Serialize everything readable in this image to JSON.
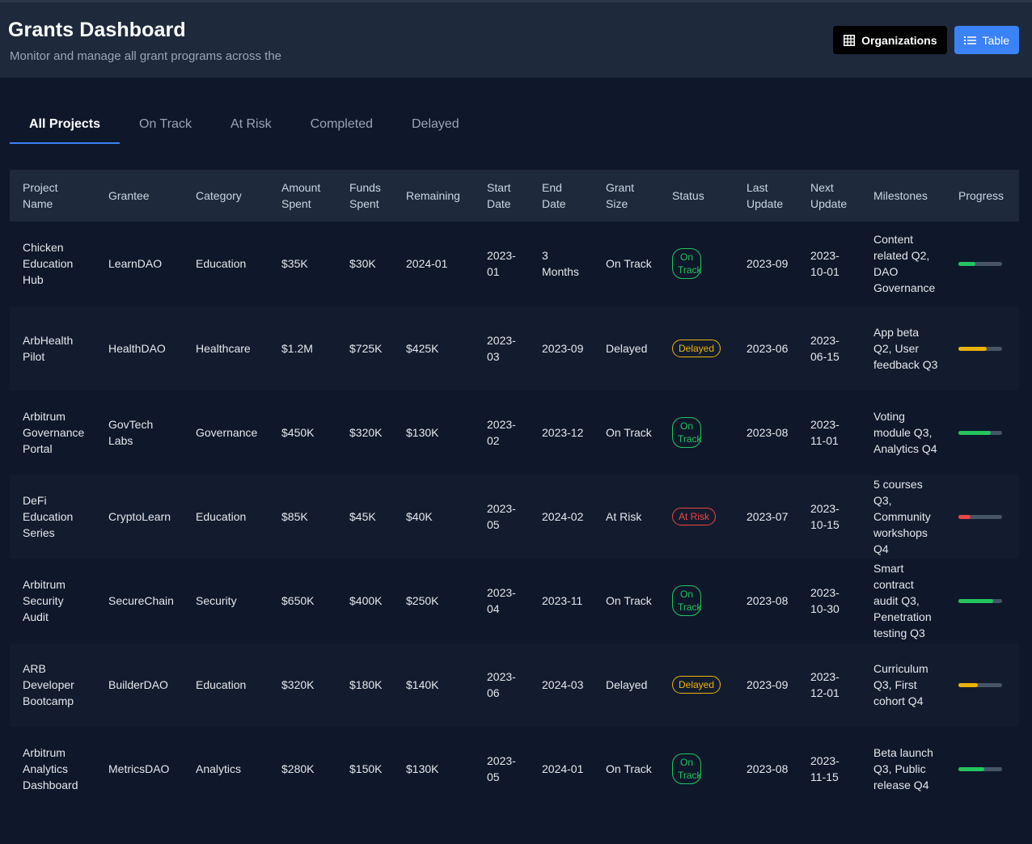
{
  "header": {
    "title": "Grants Dashboard",
    "subtitle": "Monitor and manage all grant programs across the",
    "organizations_label": "Organizations",
    "table_label": "Table"
  },
  "tabs": [
    {
      "label": "All Projects",
      "active": true
    },
    {
      "label": "On Track",
      "active": false
    },
    {
      "label": "At Risk",
      "active": false
    },
    {
      "label": "Completed",
      "active": false
    },
    {
      "label": "Delayed",
      "active": false
    }
  ],
  "table": {
    "columns": [
      "Project Name",
      "Grantee",
      "Category",
      "Amount Spent",
      "Funds Spent",
      "Remaining",
      "Start Date",
      "End Date",
      "Grant Size",
      "Status",
      "Last Update",
      "Next Update",
      "Milestones",
      "Progress"
    ],
    "rows": [
      {
        "project": "Chicken Education Hub",
        "grantee": "LearnDAO",
        "category": "Education",
        "amount_spent": "$35K",
        "funds_spent": "$30K",
        "remaining": "2024-01",
        "start": "2023-01",
        "end": "3 Months",
        "grant_size": "On Track",
        "status": "On Track",
        "status_type": "ontrack",
        "last_update": "2023-09",
        "next_update": "2023-10-01",
        "milestones": "Content related Q2, DAO Governance",
        "progress": 0.38,
        "progress_color": "#22c55e"
      },
      {
        "project": "ArbHealth Pilot",
        "grantee": "HealthDAO",
        "category": "Healthcare",
        "amount_spent": "$1.2M",
        "funds_spent": "$725K",
        "remaining": "$425K",
        "start": "2023-03",
        "end": "2023-09",
        "grant_size": "Delayed",
        "status": "Delayed",
        "status_type": "delayed",
        "last_update": "2023-06",
        "next_update": "2023-06-15",
        "milestones": "App beta Q2, User feedback Q3",
        "progress": 0.65,
        "progress_color": "#eab308"
      },
      {
        "project": "Arbitrum Governance Portal",
        "grantee": "GovTech Labs",
        "category": "Governance",
        "amount_spent": "$450K",
        "funds_spent": "$320K",
        "remaining": "$130K",
        "start": "2023-02",
        "end": "2023-12",
        "grant_size": "On Track",
        "status": "On Track",
        "status_type": "ontrack",
        "last_update": "2023-08",
        "next_update": "2023-11-01",
        "milestones": "Voting module Q3, Analytics Q4",
        "progress": 0.74,
        "progress_color": "#22c55e"
      },
      {
        "project": "DeFi Education Series",
        "grantee": "CryptoLearn",
        "category": "Education",
        "amount_spent": "$85K",
        "funds_spent": "$45K",
        "remaining": "$40K",
        "start": "2023-05",
        "end": "2024-02",
        "grant_size": "At Risk",
        "status": "At Risk",
        "status_type": "atrisk",
        "last_update": "2023-07",
        "next_update": "2023-10-15",
        "milestones": "5 courses Q3, Community workshops Q4",
        "progress": 0.28,
        "progress_color": "#ef4444"
      },
      {
        "project": "Arbitrum Security Audit",
        "grantee": "SecureChain",
        "category": "Security",
        "amount_spent": "$650K",
        "funds_spent": "$400K",
        "remaining": "$250K",
        "start": "2023-04",
        "end": "2023-11",
        "grant_size": "On Track",
        "status": "On Track",
        "status_type": "ontrack",
        "last_update": "2023-08",
        "next_update": "2023-10-30",
        "milestones": "Smart contract audit Q3, Penetration testing Q3",
        "progress": 0.8,
        "progress_color": "#22c55e"
      },
      {
        "project": "ARB Developer Bootcamp",
        "grantee": "BuilderDAO",
        "category": "Education",
        "amount_spent": "$320K",
        "funds_spent": "$180K",
        "remaining": "$140K",
        "start": "2023-06",
        "end": "2024-03",
        "grant_size": "Delayed",
        "status": "Delayed",
        "status_type": "delayed",
        "last_update": "2023-09",
        "next_update": "2023-12-01",
        "milestones": "Curriculum Q3, First cohort Q4",
        "progress": 0.45,
        "progress_color": "#eab308"
      },
      {
        "project": "Arbitrum Analytics Dashboard",
        "grantee": "MetricsDAO",
        "category": "Analytics",
        "amount_spent": "$280K",
        "funds_spent": "$150K",
        "remaining": "$130K",
        "start": "2023-05",
        "end": "2024-01",
        "grant_size": "On Track",
        "status": "On Track",
        "status_type": "ontrack",
        "last_update": "2023-08",
        "next_update": "2023-11-15",
        "milestones": "Beta launch Q3, Public release Q4",
        "progress": 0.6,
        "progress_color": "#22c55e"
      }
    ]
  }
}
